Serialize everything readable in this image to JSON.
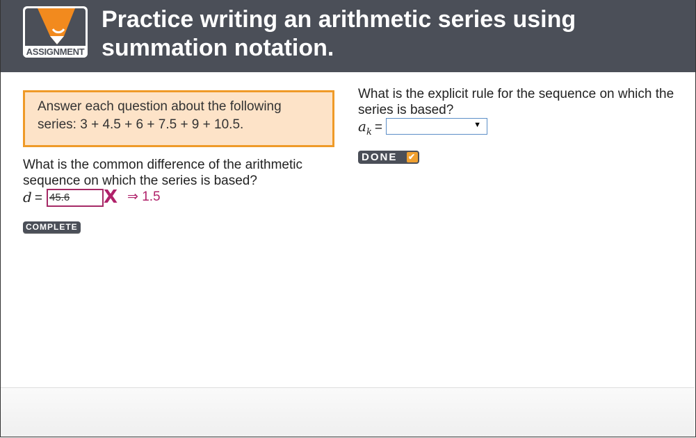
{
  "header": {
    "logo_label": "ASSIGNMENT",
    "title_line1": "Practice writing an arithmetic series using",
    "title_line2": "summation notation."
  },
  "instructions": {
    "text_line1": "Answer each question about the following",
    "text_line2": "series: 3 + 4.5 + 6 + 7.5 + 9 + 10.5."
  },
  "question1": {
    "prompt": "What is the common difference of the arithmetic sequence on which the series is based?",
    "variable": "d",
    "equals": "=",
    "answer_value": "45.6",
    "incorrect_mark": "X",
    "correct_answer": "⇒ 1.5",
    "button_label": "COMPLETE"
  },
  "question2": {
    "prompt": "What is the explicit rule for the sequence on which the series is based?",
    "variable": "a",
    "subscript": "k",
    "equals": "=",
    "select_value": "",
    "select_arrow": "▼",
    "button_label": "DONE",
    "button_check": "✔"
  },
  "colors": {
    "header_bg": "#4b4f58",
    "accent_orange": "#ef9a28",
    "instr_bg": "#fde3c8",
    "error_magenta": "#b0216a"
  }
}
